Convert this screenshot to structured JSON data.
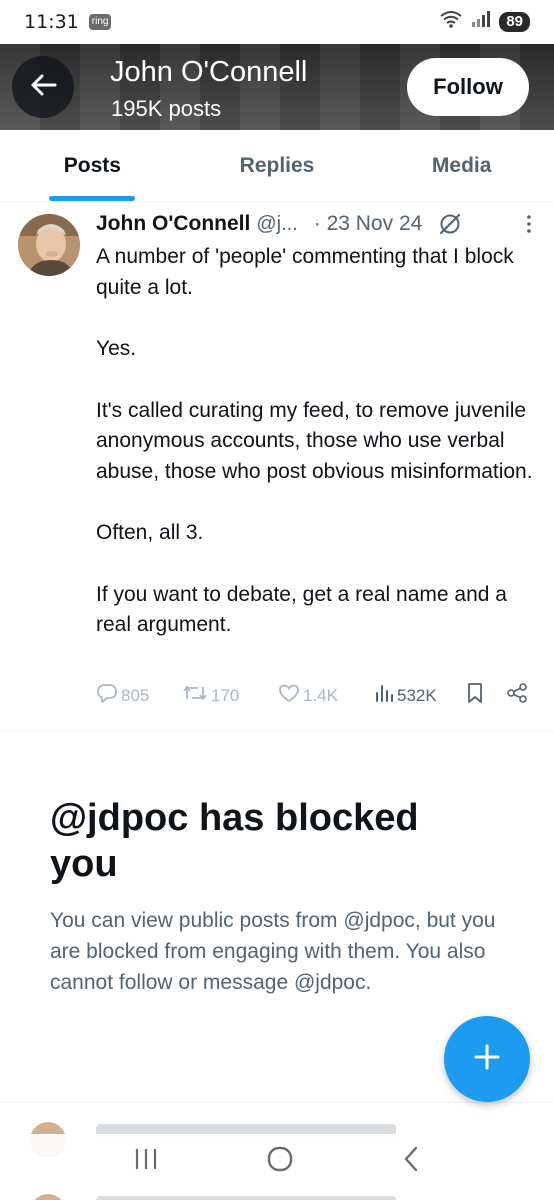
{
  "status_bar": {
    "time": "11:31",
    "app_badge": "ring",
    "battery": "89"
  },
  "header": {
    "title": "John O'Connell",
    "subtitle": "195K posts",
    "follow_label": "Follow"
  },
  "tabs": [
    {
      "label": "Posts",
      "active": true
    },
    {
      "label": "Replies",
      "active": false
    },
    {
      "label": "Media",
      "active": false
    }
  ],
  "post": {
    "author": "John O'Connell",
    "handle": "@j...",
    "date": "· 23 Nov 24",
    "paragraphs": [
      "A number of 'people' commenting that I block quite a lot.",
      "Yes.",
      "It's called curating my feed, to remove juvenile anonymous accounts, those who use verbal abuse, those who post obvious misinformation.",
      "Often, all 3.",
      "If you want to debate, get a real name and a real argument."
    ],
    "stats": {
      "replies": "805",
      "reposts": "170",
      "likes": "1.4K",
      "views": "532K"
    }
  },
  "blocked_notice": {
    "title": "@jdpoc has blocked you",
    "description": "You can view public posts from @jdpoc, but you are blocked from engaging with them. You also cannot follow or message @jdpoc."
  },
  "colors": {
    "accent": "#1d9bf0",
    "text_primary": "#0f1419",
    "text_secondary": "#536471",
    "disabled_icon": "#aab8c2"
  },
  "icons": {
    "back": "arrow-left-icon",
    "grok": "grok-icon",
    "more": "more-vertical-icon",
    "reply": "reply-icon",
    "repost": "repost-icon",
    "like": "heart-icon",
    "views": "views-icon",
    "bookmark": "bookmark-icon",
    "share": "share-icon",
    "compose": "plus-icon"
  }
}
